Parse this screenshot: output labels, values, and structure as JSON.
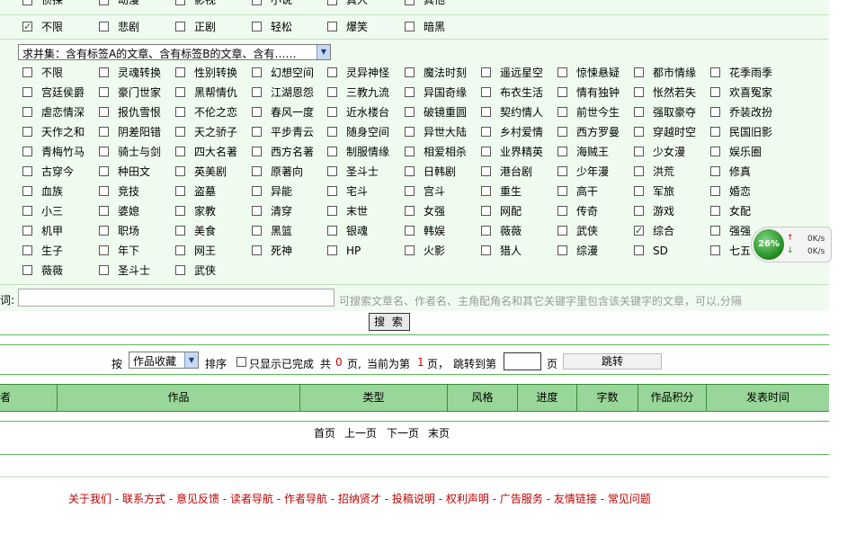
{
  "row0": [
    "侦探",
    "动漫",
    "影视",
    "小说",
    "真人",
    "其他"
  ],
  "style_row": {
    "items": [
      "不限",
      "悲剧",
      "正剧",
      "轻松",
      "爆笑",
      "暗黑"
    ],
    "checked": [
      true,
      false,
      false,
      false,
      false,
      false
    ]
  },
  "tag_mode_select": "求并集：含有标签A的文章、含有标签B的文章、含有……",
  "tags": [
    [
      "不限",
      "灵魂转换",
      "性别转换",
      "幻想空间",
      "灵异神怪",
      "魔法时刻",
      "遥远星空",
      "惊悚悬疑",
      "都市情缘",
      "花季雨季"
    ],
    [
      "宫廷侯爵",
      "豪门世家",
      "黑帮情仇",
      "江湖恩怨",
      "三教九流",
      "异国奇缘",
      "布衣生活",
      "情有独钟",
      "怅然若失",
      "欢喜冤家"
    ],
    [
      "虐恋情深",
      "报仇雪恨",
      "不伦之恋",
      "春风一度",
      "近水楼台",
      "破镜重圆",
      "契约情人",
      "前世今生",
      "强取豪夺",
      "乔装改扮"
    ],
    [
      "天作之和",
      "阴差阳错",
      "天之骄子",
      "平步青云",
      "随身空间",
      "异世大陆",
      "乡村爱情",
      "西方罗曼",
      "穿越时空",
      "民国旧影"
    ],
    [
      "青梅竹马",
      "骑士与剑",
      "四大名著",
      "西方名著",
      "制服情缘",
      "相爱相杀",
      "业界精英",
      "海贼王",
      "少女漫",
      "娱乐圈"
    ],
    [
      "古穿今",
      "种田文",
      "英美剧",
      "原著向",
      "圣斗士",
      "日韩剧",
      "港台剧",
      "少年漫",
      "洪荒",
      "修真"
    ],
    [
      "血族",
      "竞技",
      "盗墓",
      "异能",
      "宅斗",
      "宫斗",
      "重生",
      "高干",
      "军旅",
      "婚恋"
    ],
    [
      "小三",
      "婆媳",
      "家教",
      "清穿",
      "末世",
      "女强",
      "网配",
      "传奇",
      "游戏",
      "女配"
    ],
    [
      "机甲",
      "职场",
      "美食",
      "黑篮",
      "银魂",
      "韩娱",
      "薇薇",
      "武侠",
      "综合",
      "强强"
    ],
    [
      "生子",
      "年下",
      "网王",
      "死神",
      "HP",
      "火影",
      "猎人",
      "综漫",
      "SD",
      "七五"
    ],
    [
      "薇薇",
      "圣斗士",
      "武侠"
    ]
  ],
  "tag_checked": "综合",
  "keyword": {
    "label": "词:",
    "value": "",
    "hint": "可搜索文章名、作者名、主角配角名和其它关键字里包含该关键字的文章，可以,分隔"
  },
  "search_button": "搜 索",
  "sort_bar": {
    "by": "按",
    "select_value": "作品收藏",
    "order": "排序",
    "only_finished": "只显示已完成",
    "total_prefix": "共",
    "total_pages": "0",
    "pages_word": "页,",
    "current_prefix": "当前为第",
    "current_page": "1",
    "current_suffix": "页，",
    "jump_prefix": "跳转到第",
    "jump_value": "",
    "jump_suffix": "页",
    "jump_button": "跳转"
  },
  "table_headers": [
    "者",
    "作品",
    "类型",
    "风格",
    "进度",
    "字数",
    "作品积分",
    "发表时间"
  ],
  "pager": [
    "首页",
    "上一页",
    "下一页",
    "末页"
  ],
  "footer_links": [
    "关于我们",
    "联系方式",
    "意见反馈",
    "读者导航",
    "作者导航",
    "招纳贤才",
    "投稿说明",
    "权利声明",
    "广告服务",
    "友情链接",
    "常见问题"
  ],
  "footer_sep": " - ",
  "speed_widget": {
    "percent": "26%",
    "up": "0K/s",
    "down": "0K/s"
  },
  "colors": {
    "header_bg": "#99d699",
    "top_bg": "#f0fbf0",
    "footer_link": "#c00000",
    "page_highlight": "#cc0000"
  }
}
